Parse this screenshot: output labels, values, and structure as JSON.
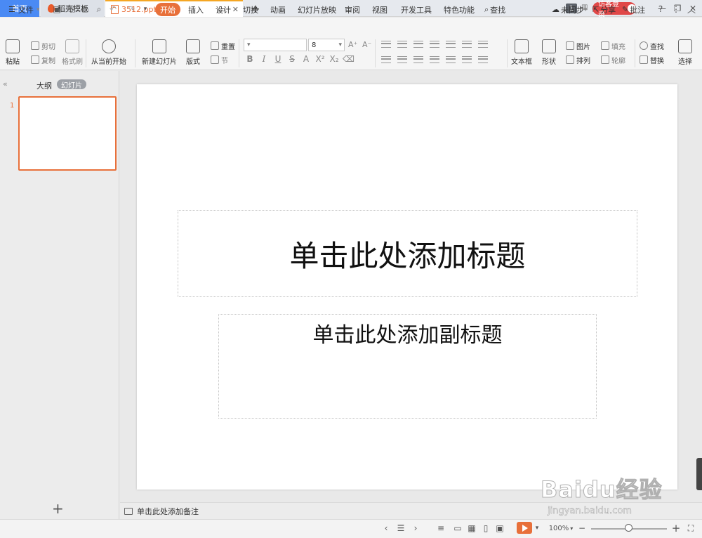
{
  "tabs": {
    "home": "首页",
    "template": "稻壳模板",
    "file": "3512.ppt",
    "add": "+"
  },
  "titlebar": {
    "count_badge": "1",
    "login_label": "访客登录"
  },
  "menu": {
    "file": "文件",
    "items": [
      "开始",
      "插入",
      "设计",
      "切换",
      "动画",
      "幻灯片放映",
      "审阅",
      "视图",
      "开发工具",
      "特色功能"
    ],
    "search": "查找",
    "sync": "未同步",
    "share": "分享",
    "comment": "批注"
  },
  "ribbon": {
    "paste": "粘贴",
    "cut": "剪切",
    "copy": "复制",
    "format_painter": "格式刷",
    "from_current": "从当前开始",
    "new_slide": "新建幻灯片",
    "layout": "版式",
    "reset": "重置",
    "section": "节",
    "font_size": "8",
    "textbox": "文本框",
    "shape": "形状",
    "picture": "图片",
    "fill": "填充",
    "arrange": "排列",
    "outline": "轮廓",
    "find": "查找",
    "replace": "替换",
    "select": "选择"
  },
  "left_panel": {
    "outline_tab": "大纲",
    "slides_tab": "幻灯片",
    "slide_number": "1"
  },
  "slide": {
    "title_placeholder": "单击此处添加标题",
    "subtitle_placeholder": "单击此处添加副标题"
  },
  "notes": {
    "placeholder": "单击此处添加备注"
  },
  "status": {
    "zoom": "100%"
  },
  "watermark": {
    "main": "Baidu经验",
    "url": "jingyan.baidu.com"
  },
  "colors": {
    "accent": "#e8703a",
    "home_tab": "#4a8af4",
    "login": "#e04848"
  }
}
